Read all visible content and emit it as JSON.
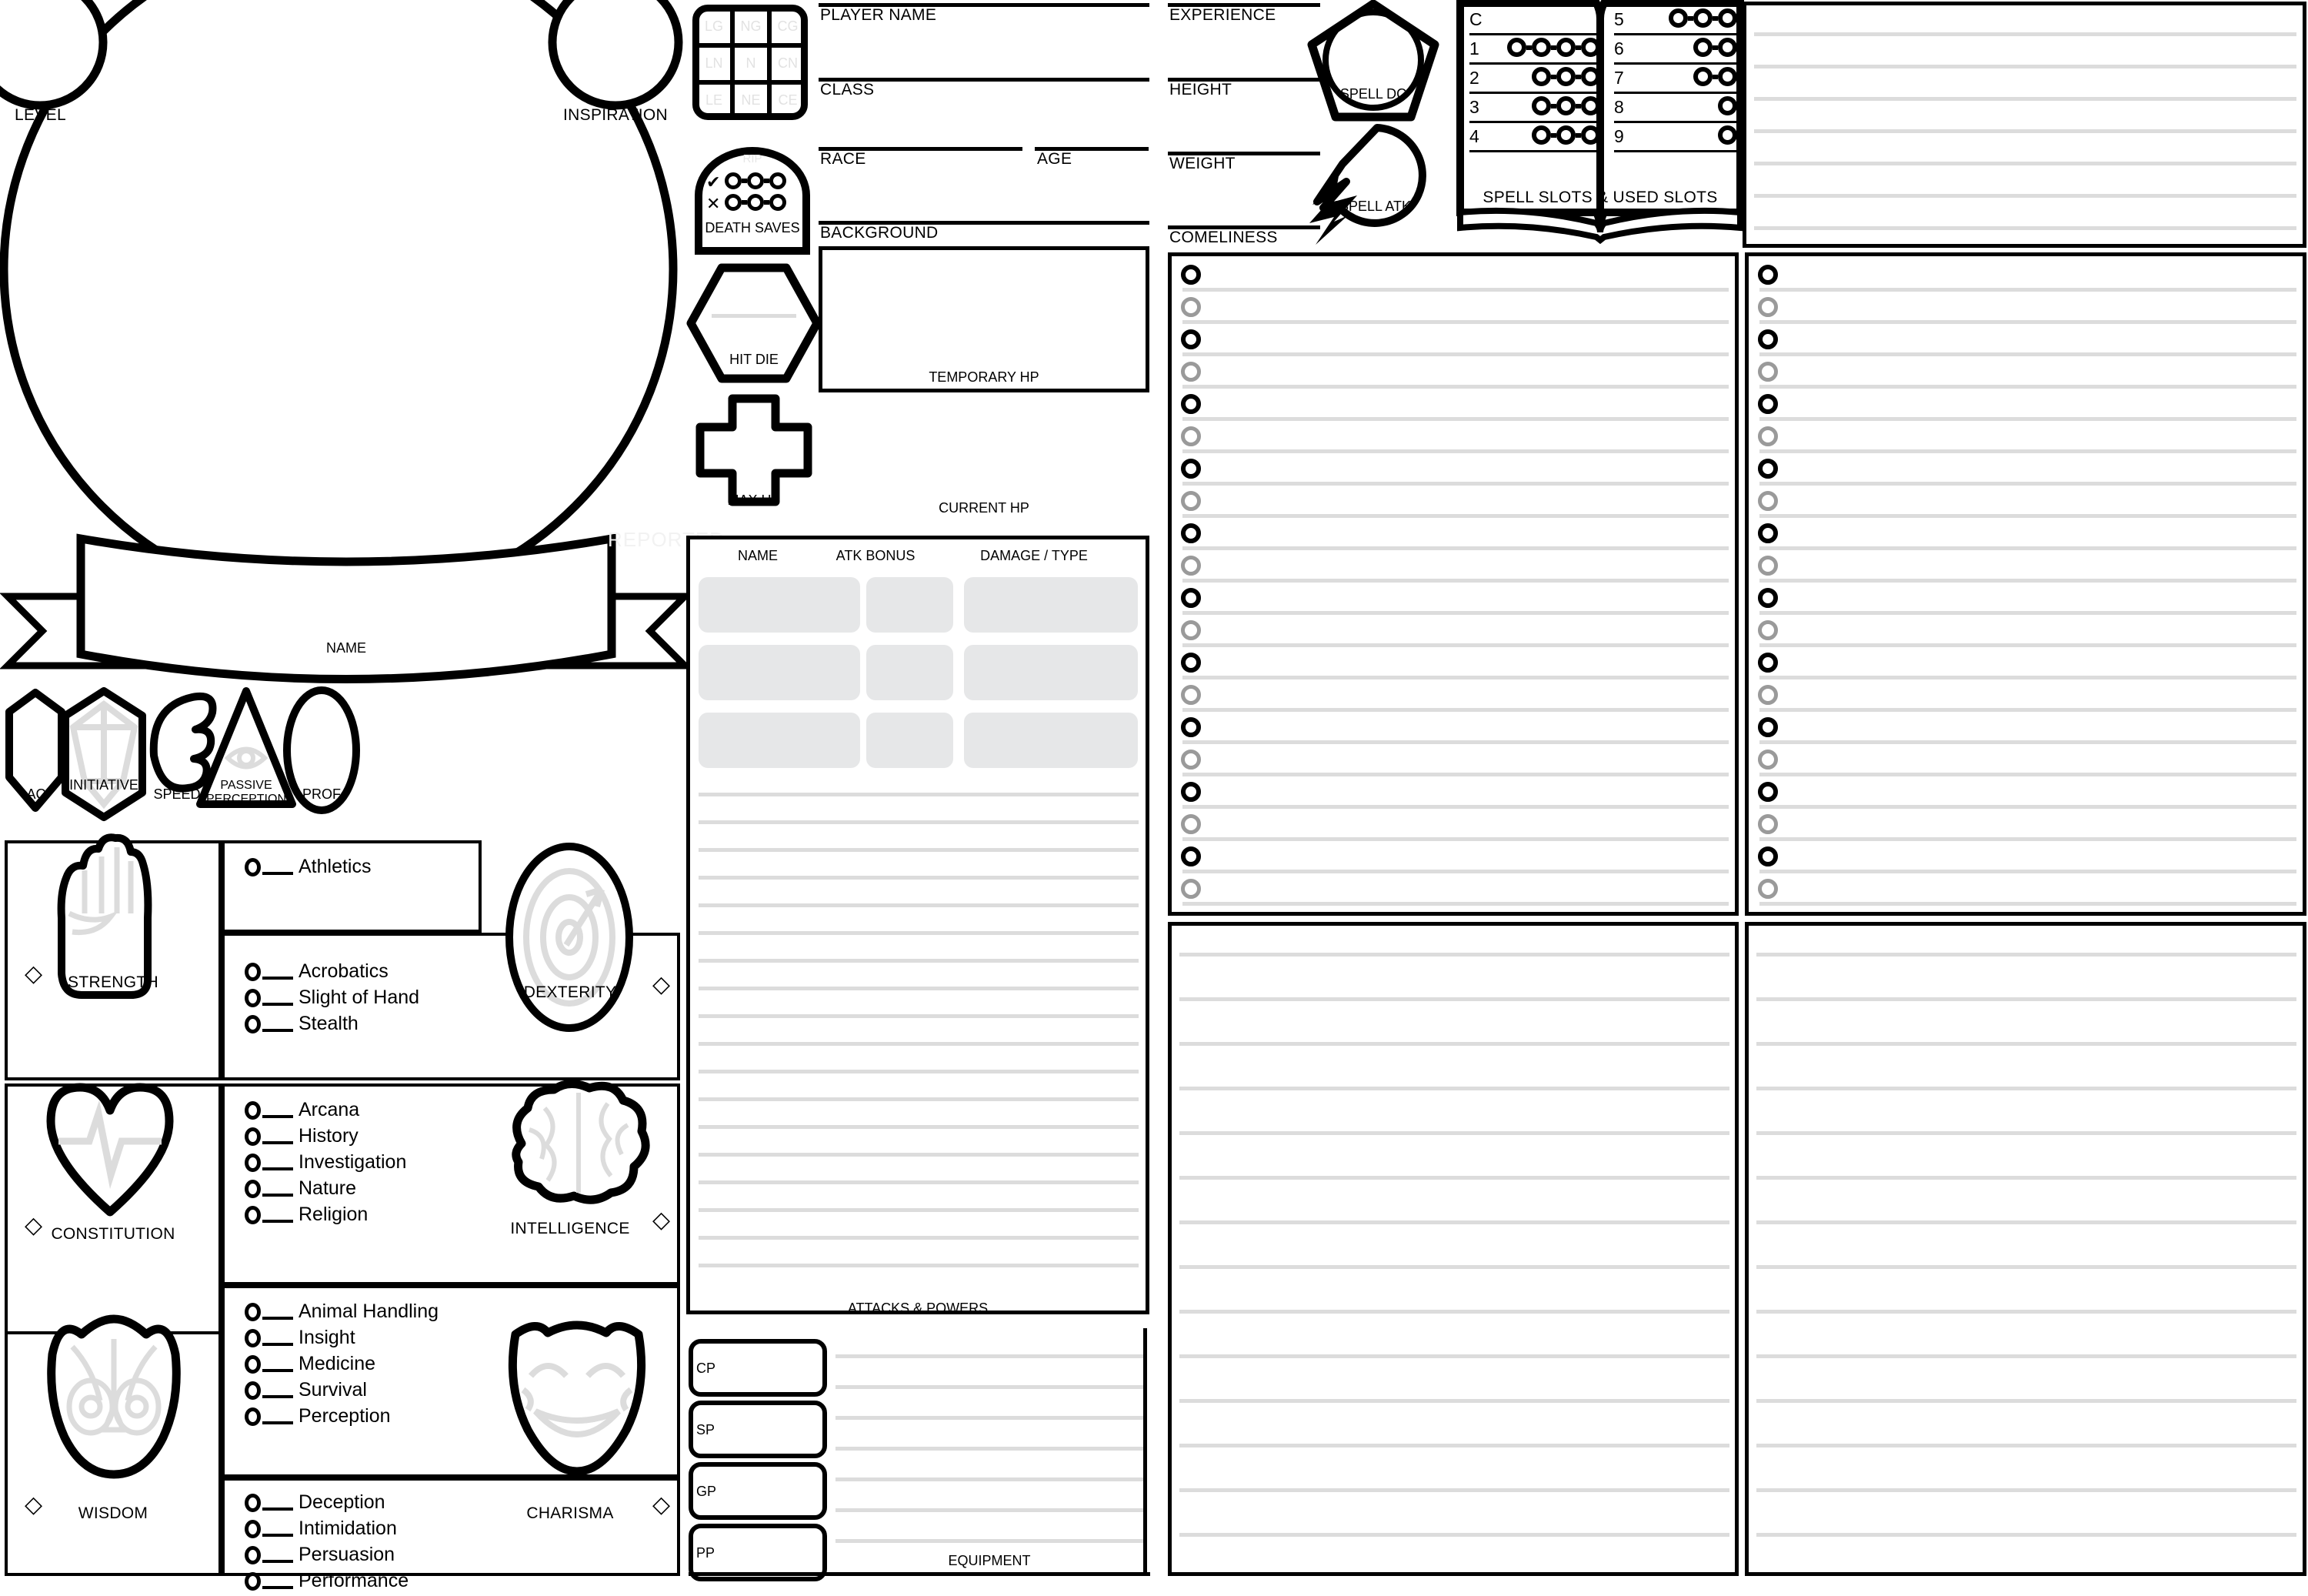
{
  "sheet": {
    "watermark": "REPORTED",
    "name_banner_label": "NAME",
    "level_label": "LEVEL",
    "inspiration_label": "INSPIRATION"
  },
  "alignment": {
    "cells": [
      "LG",
      "NG",
      "CG",
      "LN",
      "N",
      "CN",
      "LE",
      "NE",
      "CE"
    ]
  },
  "death_saves": {
    "title": "DEATH SAVES",
    "rip": "RIP",
    "success_mark": "✔",
    "failure_mark": "✕",
    "success_count": 3,
    "failure_count": 3
  },
  "hit_die": {
    "label": "HIT DIE"
  },
  "max_hp": {
    "label": "MAX HP"
  },
  "identity": {
    "player_name": "PLAYER NAME",
    "class": "CLASS",
    "race": "RACE",
    "age": "AGE",
    "background": "BACKGROUND"
  },
  "vitals": {
    "experience": "EXPERIENCE",
    "height": "HEIGHT",
    "weight": "WEIGHT",
    "comeliness": "COMELINESS"
  },
  "hp": {
    "temporary": "TEMPORARY HP",
    "current": "CURRENT HP"
  },
  "spell_badges": {
    "spell_dc": "SPELL DC",
    "spell_atk": "SPELL ATK"
  },
  "spell_slots": {
    "title": "SPELL SLOTS & USED SLOTS",
    "left_rows": [
      {
        "level": "C",
        "slots": 0
      },
      {
        "level": "1",
        "slots": 4
      },
      {
        "level": "2",
        "slots": 3
      },
      {
        "level": "3",
        "slots": 3
      },
      {
        "level": "4",
        "slots": 3
      }
    ],
    "right_rows": [
      {
        "level": "5",
        "slots": 3
      },
      {
        "level": "6",
        "slots": 2
      },
      {
        "level": "7",
        "slots": 2
      },
      {
        "level": "8",
        "slots": 1
      },
      {
        "level": "9",
        "slots": 1
      }
    ]
  },
  "stats_row": [
    {
      "name": "AC",
      "label": "AC",
      "icon": "shield-icon"
    },
    {
      "name": "INITIATIVE",
      "label": "INITIATIVE",
      "icon": "d20-icon"
    },
    {
      "name": "SPEED",
      "label": "SPEED",
      "icon": "wing-icon"
    },
    {
      "name": "PASSIVE PERCEPTION",
      "label_line1": "PASSIVE",
      "label_line2": "PERCEPTION",
      "icon": "eye-icon"
    },
    {
      "name": "PROF",
      "label": "PROF",
      "icon": "oval-icon"
    }
  ],
  "abilities": [
    {
      "name": "STRENGTH",
      "icon": "fist-icon",
      "skills": [
        "Athletics"
      ]
    },
    {
      "name": "DEXTERITY",
      "icon": "target-icon",
      "skills": [
        "Acrobatics",
        "Slight of Hand",
        "Stealth"
      ]
    },
    {
      "name": "CONSTITUTION",
      "icon": "heart-pulse-icon",
      "skills": []
    },
    {
      "name": "INTELLIGENCE",
      "icon": "brain-icon",
      "skills": [
        "Arcana",
        "History",
        "Investigation",
        "Nature",
        "Religion"
      ]
    },
    {
      "name": "WISDOM",
      "icon": "owl-icon",
      "skills": [
        "Animal Handling",
        "Insight",
        "Medicine",
        "Survival",
        "Perception"
      ]
    },
    {
      "name": "CHARISMA",
      "icon": "mask-icon",
      "skills": [
        "Deception",
        "Intimidation",
        "Persuasion",
        "Performance"
      ]
    }
  ],
  "attacks": {
    "headers": [
      "NAME",
      "ATK BONUS",
      "DAMAGE / TYPE"
    ],
    "rows": [
      {
        "name": "",
        "atk_bonus": "",
        "damage": ""
      },
      {
        "name": "",
        "atk_bonus": "",
        "damage": ""
      },
      {
        "name": "",
        "atk_bonus": "",
        "damage": ""
      }
    ],
    "footer": "ATTACKS & POWERS",
    "lined_rows": 13
  },
  "currency": {
    "boxes": [
      "CP",
      "SP",
      "GP",
      "PP"
    ]
  },
  "equipment": {
    "footer": "EQUIPMENT",
    "lined_rows": 8
  },
  "spell_lists": {
    "top_right_notes_lines": 7,
    "column_rows": 20,
    "bottom_lines": 14
  }
}
